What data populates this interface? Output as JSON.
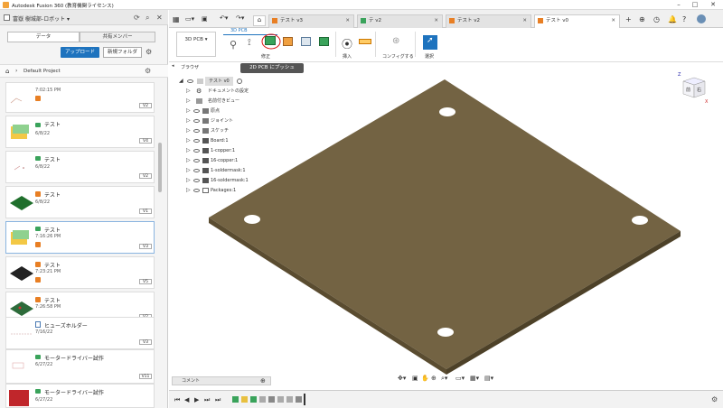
{
  "window": {
    "title": "Autodesk Fusion 360 (教育機関ライセンス)"
  },
  "hub": {
    "name": "富嶽 樹城部-ロボット"
  },
  "panel": {
    "tabs": [
      "データ",
      "共有メンバー"
    ],
    "upload_label": "アップロード",
    "newfolder_label": "新規フォルダ",
    "project": "Default Project"
  },
  "files": [
    {
      "name": "",
      "date": "7:02:15 PM",
      "version": "V2"
    },
    {
      "name": "テスト",
      "date": "6/8/22",
      "version": "V4"
    },
    {
      "name": "テスト",
      "date": "6/8/22",
      "version": "V2"
    },
    {
      "name": "テスト",
      "date": "6/8/22",
      "version": "V1"
    },
    {
      "name": "テスト",
      "date": "7:16:26 PM",
      "version": "V3"
    },
    {
      "name": "テスト",
      "date": "7:23:21 PM",
      "version": "V5"
    },
    {
      "name": "テスト",
      "date": "7:26:58 PM",
      "version": "V2"
    },
    {
      "name": "ヒューズホルダー",
      "date": "7/16/22",
      "version": "V3"
    },
    {
      "name": "モータードライバー試作",
      "date": "6/27/22",
      "version": "V11"
    },
    {
      "name": "モータードライバー試作",
      "date": "6/27/22",
      "version": "V2"
    }
  ],
  "doc_tabs": [
    {
      "label": "テスト v3",
      "active": false
    },
    {
      "label": "テ v2",
      "active": false
    },
    {
      "label": "テスト v2",
      "active": false
    },
    {
      "label": "テスト v0",
      "active": true
    }
  ],
  "toolbar": {
    "workspace": "3D PCB",
    "section_label": "3D PCB",
    "groups": [
      "修正",
      "挿入",
      "コンフィグする",
      "選択"
    ]
  },
  "tooltip": "2D PCB にプッシュ",
  "browser": {
    "header": "ブラウザ",
    "root": "テスト v0",
    "rows": [
      "ドキュメントの設定",
      "名前付きビュー",
      "原点",
      "ジョイント",
      "スケッチ",
      "Board:1",
      "1-copper:1",
      "16-copper:1",
      "1-soldermask:1",
      "16-soldermask:1",
      "Packages:1"
    ]
  },
  "comment_label": "コメント",
  "viewcube": {
    "front": "前",
    "right": "右",
    "top": "上"
  },
  "colors": {
    "board": "#736343",
    "board_side": "#5a4c30",
    "accent": "#1e73be"
  }
}
